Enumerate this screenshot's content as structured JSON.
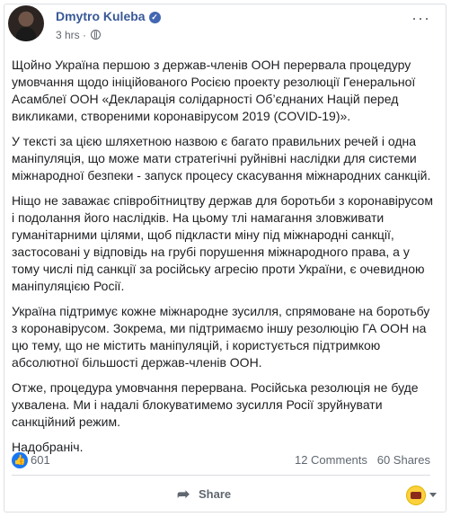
{
  "post": {
    "author": "Dmytro Kuleba",
    "time": "3 hrs",
    "separator": "·",
    "paragraphs": [
      "Щойно Україна першою з держав-членів ООН перервала процедуру умовчання щодо ініційованого Росією проекту резолюції Генеральної Асамблеї ООН «Декларація солідарності Об’єднаних Націй перед викликами, створеними коронавірусом 2019 (COVID-19)».",
      "У тексті за цією шляхетною назвою є багато правильних речей і одна маніпуляція, що може мати стратегічні руйнівні наслідки для системи міжнародної безпеки - запуск процесу скасування міжнародних санкцій.",
      "Ніщо не заважає співробітництву держав для боротьби з коронавірусом і подолання його наслідків. На цьому тлі намагання зловживати гуманітарними цілями, щоб підкласти міну під міжнародні санкції, застосовані у відповідь на грубі порушення міжнародного права, а у тому числі під санкції за російську агресію проти України, є очевидною маніпуляцією Росії.",
      "Україна підтримує кожне міжнародне зусилля, спрямоване на боротьбу з коронавірусом. Зокрема, ми підтримаємо іншу резолюцію ГА ООН на цю тему, що не містить маніпуляцій, і користується підтримкою абсолютної більшості держав-членів ООН.",
      "Отже, процедура умовчання перервана. Російська резолюція не буде ухвалена. Ми і надалі блокуватимемо зусилля Росії зруйнувати санкційний режим.",
      "Надобраніч."
    ]
  },
  "stats": {
    "likes": "601",
    "comments": "12 Comments",
    "shares": "60 Shares"
  },
  "actions": {
    "share": "Share"
  },
  "icons": {
    "verified": "verified-badge-icon",
    "privacy": "globe-icon",
    "like": "thumbs-up-icon",
    "share": "share-arrow-icon"
  },
  "colors": {
    "author_link": "#385898",
    "like_blue": "#1877f2",
    "muted": "#606770"
  }
}
